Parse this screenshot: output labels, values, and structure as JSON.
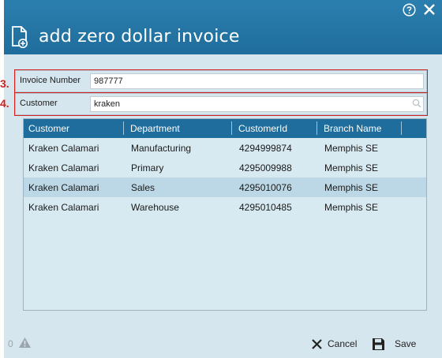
{
  "dialog": {
    "title": "add zero dollar invoice",
    "help_icon": "question-circle-icon",
    "close_icon": "close-icon",
    "title_icon": "new-document-icon"
  },
  "form": {
    "invoice_number": {
      "step": "3.",
      "label": "Invoice Number",
      "value": "987777"
    },
    "customer": {
      "step": "4.",
      "label": "Customer",
      "value": "kraken",
      "icon": "search-icon"
    }
  },
  "grid": {
    "columns": [
      "Customer",
      "Department",
      "CustomerId",
      "Branch Name"
    ],
    "rows": [
      {
        "customer": "Kraken Calamari",
        "department": "Manufacturing",
        "customer_id": "4294999874",
        "branch": "Memphis SE"
      },
      {
        "customer": "Kraken Calamari",
        "department": "Primary",
        "customer_id": "4295009988",
        "branch": "Memphis SE"
      },
      {
        "customer": "Kraken Calamari",
        "department": "Sales",
        "customer_id": "4295010076",
        "branch": "Memphis SE"
      },
      {
        "customer": "Kraken Calamari",
        "department": "Warehouse",
        "customer_id": "4295010485",
        "branch": "Memphis SE"
      }
    ],
    "selected_row_index": 2
  },
  "footer": {
    "warning_count": "0",
    "warning_icon": "warning-triangle-icon",
    "cancel_label": "Cancel",
    "cancel_icon": "x-icon",
    "save_label": "Save",
    "save_icon": "floppy-disk-icon"
  },
  "colors": {
    "header_bg": "#1f6d9c",
    "panel_bg": "#d6e6ee",
    "grid_header_bg": "#1e6d9c",
    "selected_row_bg": "#bcd8e6",
    "highlight": "#d02020"
  }
}
